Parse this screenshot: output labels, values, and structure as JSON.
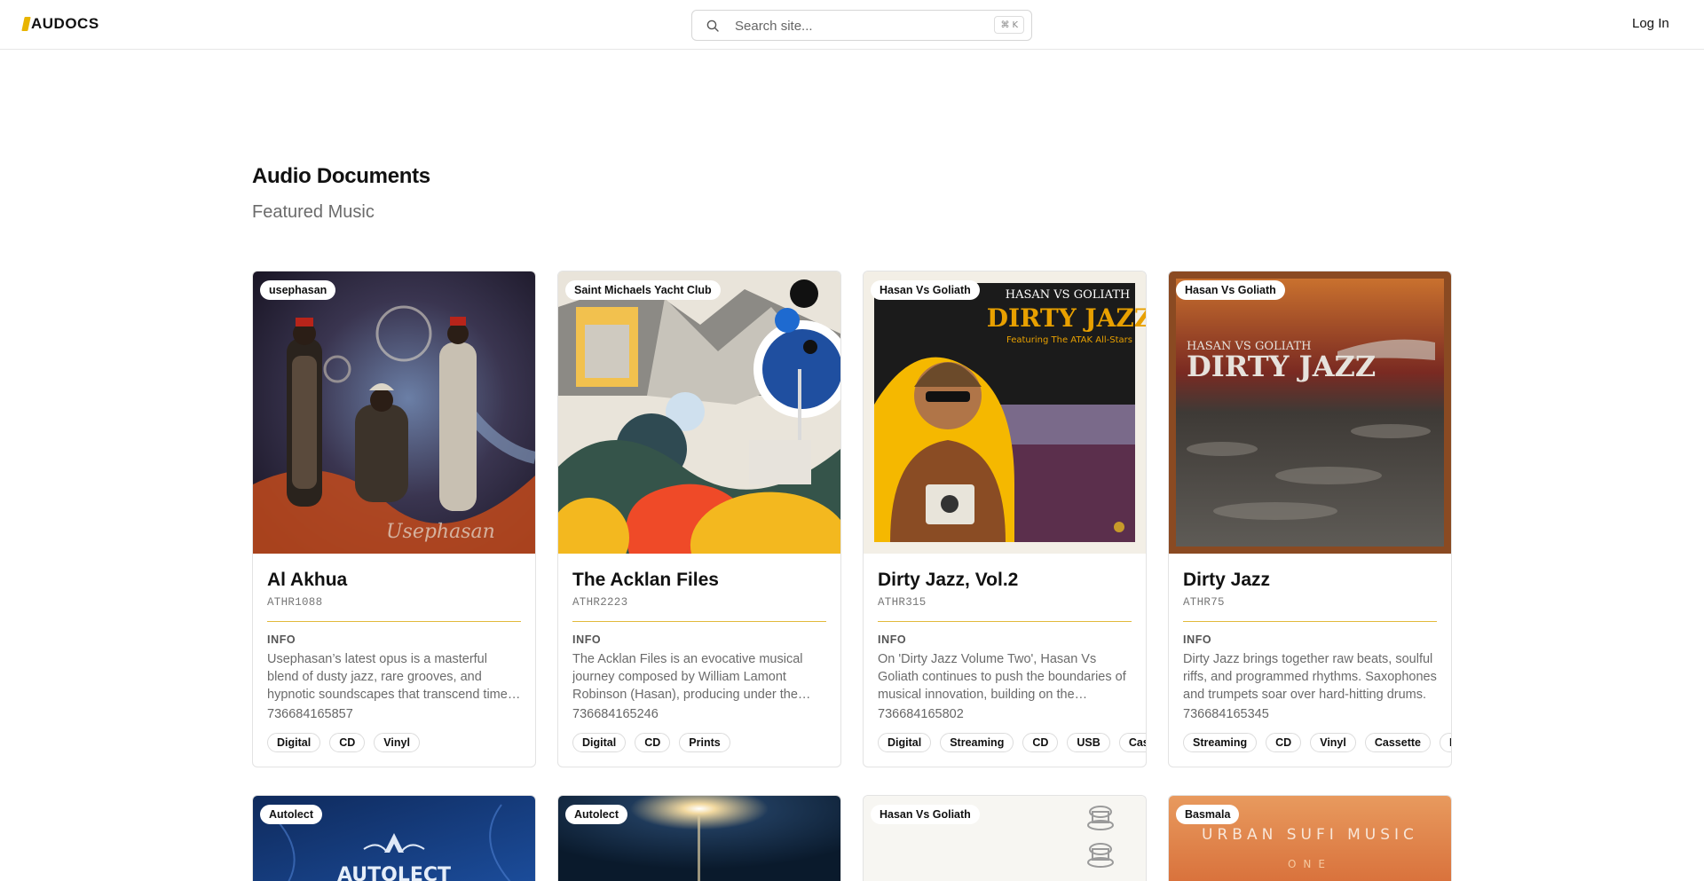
{
  "app": {
    "logo_text": "AUDOCS"
  },
  "search": {
    "placeholder": "Search site...",
    "shortcut_mod": "⌘",
    "shortcut_key": "K"
  },
  "header": {
    "login_label": "Log In"
  },
  "page": {
    "title": "Audio Documents",
    "subtitle": "Featured Music"
  },
  "cards": [
    {
      "label": "usephasan",
      "title": "Al Akhua",
      "code": "ATHR1088",
      "info_label": "INFO",
      "description": "Usephasan’s latest opus is a masterful blend of dusty jazz, rare grooves, and hypnotic soundscapes that transcend time and space.",
      "number": "736684165857",
      "tags": [
        "Digital",
        "CD",
        "Vinyl"
      ]
    },
    {
      "label": "Saint Michaels Yacht Club",
      "title": "The Acklan Files",
      "code": "ATHR2223",
      "info_label": "INFO",
      "description": "The Acklan Files is an evocative musical journey composed by William Lamont Robinson (Hasan), producing under the name Saint Michaels Yacht Club.",
      "number": "736684165246",
      "tags": [
        "Digital",
        "CD",
        "Prints"
      ]
    },
    {
      "label": "Hasan Vs Goliath",
      "title": "Dirty Jazz, Vol.2",
      "code": "ATHR315",
      "info_label": "INFO",
      "description": "On 'Dirty Jazz Volume Two', Hasan Vs Goliath continues to push the boundaries of musical innovation, building on the foundation of the first volume.",
      "number": "736684165802",
      "tags": [
        "Digital",
        "Streaming",
        "CD",
        "USB",
        "Cassette"
      ]
    },
    {
      "label": "Hasan Vs Goliath",
      "title": "Dirty Jazz",
      "code": "ATHR75",
      "info_label": "INFO",
      "description": "Dirty Jazz brings together raw beats, soulful riffs, and programmed rhythms. Saxophones and trumpets soar over hard-hitting drums.",
      "number": "736684165345",
      "tags": [
        "Streaming",
        "CD",
        "Vinyl",
        "Cassette",
        "Prints"
      ]
    }
  ],
  "cards_row2": [
    {
      "label": "Autolect",
      "art_text": "AUTOLECT"
    },
    {
      "label": "Autolect"
    },
    {
      "label": "Hasan Vs Goliath"
    },
    {
      "label": "Basmala",
      "art_text": "URBAN SUFI MUSIC",
      "art_subtext": "ONE"
    }
  ],
  "art": {
    "card3_title": "DIRTY JAZZ",
    "card3_top": "HASAN VS GOLIATH",
    "card3_feature": "Featuring The ATAK All-Stars",
    "card4_top": "HASAN VS GOLIATH",
    "card4_title": "DIRTY JAZZ"
  }
}
